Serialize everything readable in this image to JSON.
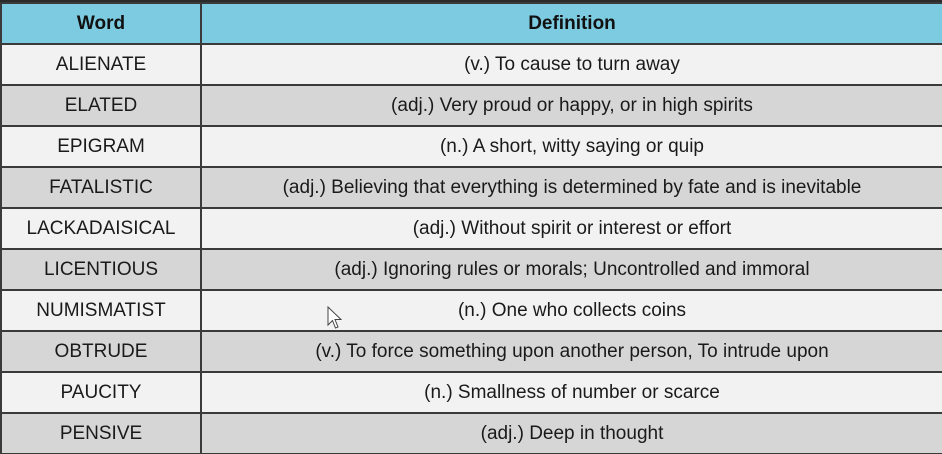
{
  "table": {
    "headers": {
      "word": "Word",
      "definition": "Definition"
    },
    "rows": [
      {
        "word": "ALIENATE",
        "definition": "(v.) To cause to turn away"
      },
      {
        "word": "ELATED",
        "definition": "(adj.) Very proud or happy, or in high spirits"
      },
      {
        "word": "EPIGRAM",
        "definition": "(n.) A short, witty saying or quip"
      },
      {
        "word": "FATALISTIC",
        "definition": "(adj.) Believing that everything is determined by fate and is inevitable"
      },
      {
        "word": "LACKADAISICAL",
        "definition": "(adj.) Without spirit or interest or effort"
      },
      {
        "word": "LICENTIOUS",
        "definition": "(adj.) Ignoring rules or morals; Uncontrolled and immoral"
      },
      {
        "word": "NUMISMATIST",
        "definition": "(n.) One who collects coins"
      },
      {
        "word": "OBTRUDE",
        "definition": "(v.) To force something upon another person, To intrude upon"
      },
      {
        "word": "PAUCITY",
        "definition": "(n.) Smallness of number or scarce"
      },
      {
        "word": "PENSIVE",
        "definition": "(adj.) Deep in thought"
      }
    ]
  },
  "colors": {
    "header": "#7ccbe0",
    "row_light": "#f2f2f2",
    "row_dark": "#d6d6d6",
    "border": "#3a3a3a"
  },
  "cursor": {
    "icon": "mouse-pointer-icon"
  }
}
